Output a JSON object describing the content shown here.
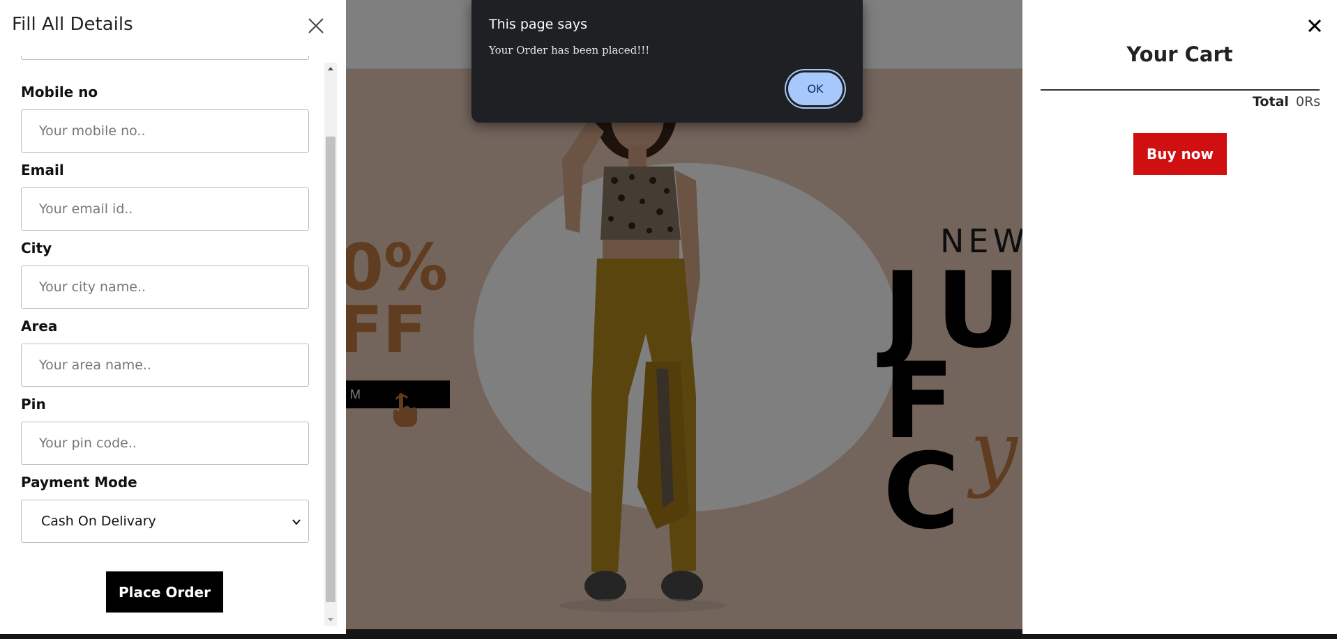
{
  "alert": {
    "title": "This page says",
    "message": "Your Order has been placed!!!",
    "ok_label": "OK"
  },
  "form_panel": {
    "title": "Fill All Details",
    "close_icon": "close-icon",
    "fields": [
      {
        "label": "Mobile no",
        "placeholder": "Your mobile no.."
      },
      {
        "label": "Email",
        "placeholder": "Your email id.."
      },
      {
        "label": "City",
        "placeholder": "Your city name.."
      },
      {
        "label": "Area",
        "placeholder": "Your area name.."
      },
      {
        "label": "Pin",
        "placeholder": "Your pin code.."
      }
    ],
    "payment": {
      "label": "Payment Mode",
      "selected": "Cash On Delivary"
    },
    "submit_label": "Place Order"
  },
  "cart_panel": {
    "title": "Your Cart",
    "total_label": "Total",
    "total_value": "0Rs",
    "buy_label": "Buy now",
    "close_icon": "close-icon"
  },
  "hero": {
    "discount_text": "0%\nFF",
    "shop_button_text": "M",
    "headline_small": "NEW",
    "headline_big": "JU\nF C",
    "script_text": "y"
  },
  "colors": {
    "hero_bg": "#e7cbb9",
    "accent_orange": "#c07a43",
    "buy_red": "#d01010",
    "alert_bg": "#1f2023",
    "alert_button": "#a8c7fa"
  }
}
